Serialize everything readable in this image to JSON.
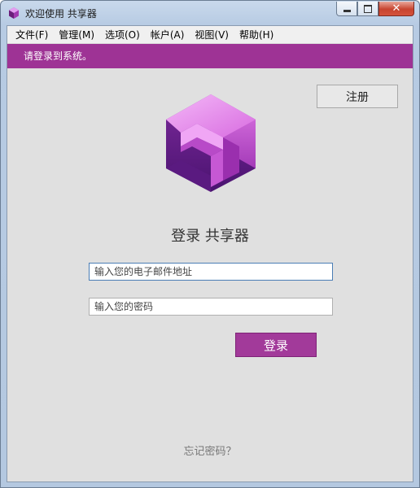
{
  "window": {
    "title": "欢迎使用 共享器",
    "close_glyph": "✕"
  },
  "menu": {
    "items": [
      "文件(F)",
      "管理(M)",
      "选项(O)",
      "帐户(A)",
      "视图(V)",
      "帮助(H)"
    ]
  },
  "banner": {
    "text": "请登录到系统。"
  },
  "register_button": {
    "label": "注册"
  },
  "heading": {
    "text": "登录 共享器"
  },
  "email": {
    "placeholder": "输入您的电子邮件地址"
  },
  "password": {
    "placeholder": "输入您的密码"
  },
  "login_button": {
    "label": "登录"
  },
  "forgot": {
    "text": "忘记密码？"
  },
  "colors": {
    "accent": "#9e3395",
    "button": "#a23a9a",
    "background": "#e0e0e0"
  },
  "icons": {
    "app": "hexagon-logo-icon",
    "minimize": "minimize-icon",
    "maximize": "maximize-icon",
    "close": "close-icon"
  }
}
